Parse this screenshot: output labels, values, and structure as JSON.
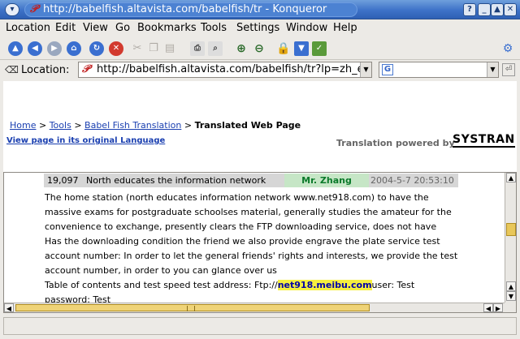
{
  "window": {
    "title": "http://babelfish.altavista.com/babelfish/tr - Konqueror",
    "buttons": {
      "help": "?",
      "minimize": "_",
      "maximize": "▲",
      "close": "✕"
    }
  },
  "menubar": [
    "Location",
    "Edit",
    "View",
    "Go",
    "Bookmarks",
    "Tools",
    "Settings",
    "Window",
    "Help"
  ],
  "toolbar": {
    "icons": [
      "up-arrow-icon",
      "back-arrow-icon",
      "forward-arrow-icon",
      "home-icon",
      "reload-icon",
      "stop-icon",
      "cut-icon",
      "copy-icon",
      "paste-icon",
      "print-icon",
      "print-preview-icon",
      "zoom-in-icon",
      "zoom-out-icon",
      "lock-icon",
      "download-icon",
      "spellcheck-icon",
      "konqueror-gear-icon"
    ]
  },
  "location": {
    "label": "Location:",
    "url": "http://babelfish.altavista.com/babelfish/tr?lp=zh_en&",
    "search_placeholder": "",
    "search_engine_icon": "google-g-icon"
  },
  "page": {
    "breadcrumb": {
      "home": "Home",
      "sep": ">",
      "tools": "Tools",
      "babel": "Babel Fish Translation",
      "current": "Translated Web Page"
    },
    "original_link": "View page in its original Language",
    "powered_by": "Translation powered by",
    "systran": "SYSTRAN"
  },
  "post": {
    "number": "19,097",
    "title": "North educates the information network",
    "author": "Mr. Zhang",
    "datetime": "2004-5-7 20:53:10",
    "paragraph1": "The home station (north educates information network www.net918.com) to have the massive exams for postgraduate schoolses material, generally studies the amateur for the convenience to exchange, presently clears the FTP downloading service, does not have",
    "paragraph2": "Has the downloading condition the friend we also provide engrave the plate service test account number: In order to let the general friends' rights and interests, we provide the test account number, in order to you can glance over us",
    "paragraph3_pre": "Table of contents and test speed test address: Ftp://",
    "paragraph3_link": "net918.meibu.com",
    "paragraph3_post": "user: Test password: Test"
  },
  "colors": {
    "titlebar": "#3d72c8",
    "link": "#1a3fb0",
    "author": "#0a7a2a",
    "highlight": "#f6ef3e"
  }
}
